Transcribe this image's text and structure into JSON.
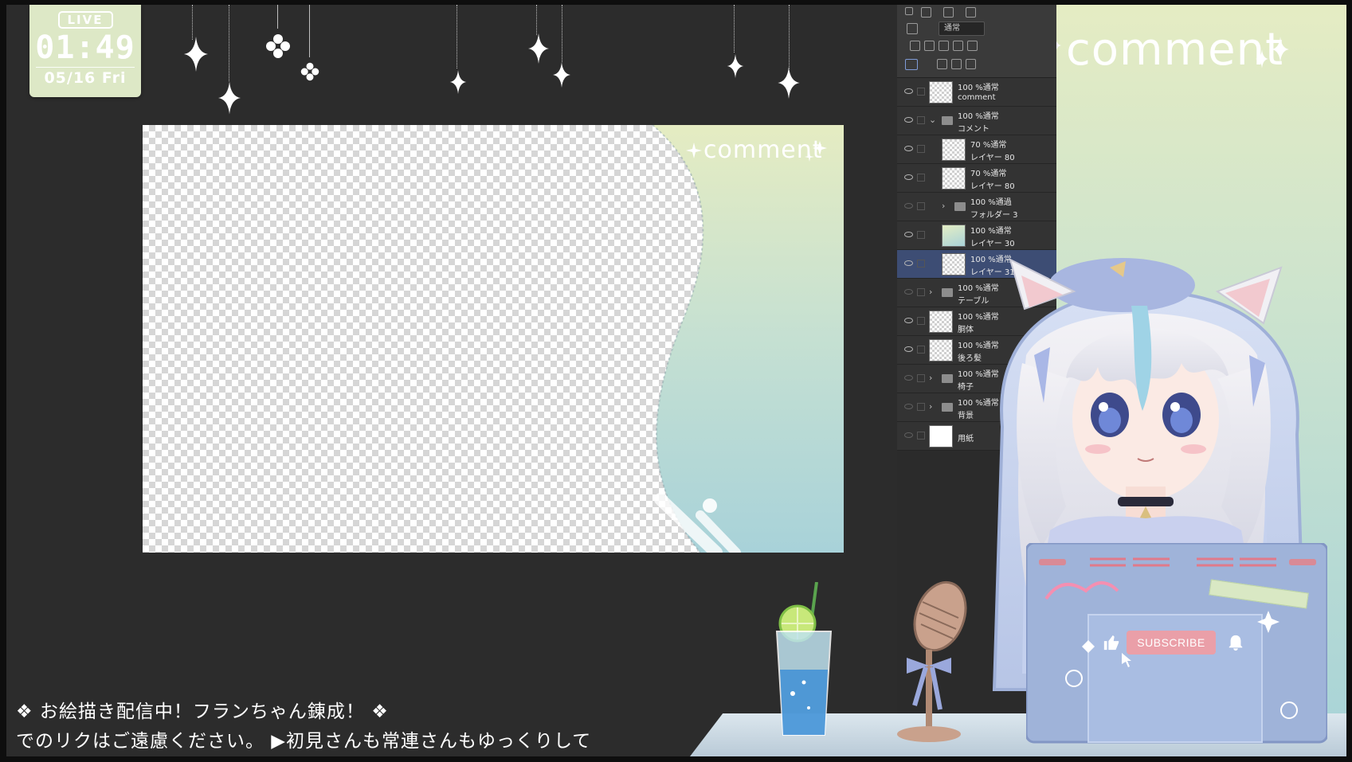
{
  "clock": {
    "badge": "LIVE",
    "time": "01:49",
    "date": "05/16 Fri"
  },
  "canvas": {
    "panel_title": "comment"
  },
  "overlay": {
    "comment_title": "comment",
    "accent_color": "#dde8c6"
  },
  "layers_panel": {
    "blend_mode": "通常",
    "layers": [
      {
        "mode": "100 %通常",
        "name": "comment",
        "kind": "layer"
      },
      {
        "mode": "100 %通常",
        "name": "コメント",
        "kind": "folder-open"
      },
      {
        "mode": "70 %通常",
        "name": "レイヤー 80",
        "kind": "layer"
      },
      {
        "mode": "70 %通常",
        "name": "レイヤー 80",
        "kind": "layer"
      },
      {
        "mode": "100 %通過",
        "name": "フォルダー 3",
        "kind": "folder"
      },
      {
        "mode": "100 %通常",
        "name": "レイヤー 30",
        "kind": "layer"
      },
      {
        "mode": "100 %通常",
        "name": "レイヤー 31",
        "kind": "layer",
        "selected": true
      },
      {
        "mode": "100 %通常",
        "name": "テーブル",
        "kind": "folder"
      },
      {
        "mode": "100 %通常",
        "name": "胴体",
        "kind": "layer"
      },
      {
        "mode": "100 %通常",
        "name": "後ろ髪",
        "kind": "layer"
      },
      {
        "mode": "100 %通常",
        "name": "椅子",
        "kind": "folder"
      },
      {
        "mode": "100 %通常",
        "name": "背景",
        "kind": "folder"
      },
      {
        "mode": "",
        "name": "用紙",
        "kind": "paper"
      }
    ]
  },
  "laptop": {
    "subscribe_label": "SUBSCRIBE"
  },
  "ticker": {
    "line1": "❖ お絵描き配信中！フランちゃん錬成！ ❖",
    "line2": "でのリクはご遠慮ください。 ▶初見さんも常連さんもゆっくりして"
  }
}
